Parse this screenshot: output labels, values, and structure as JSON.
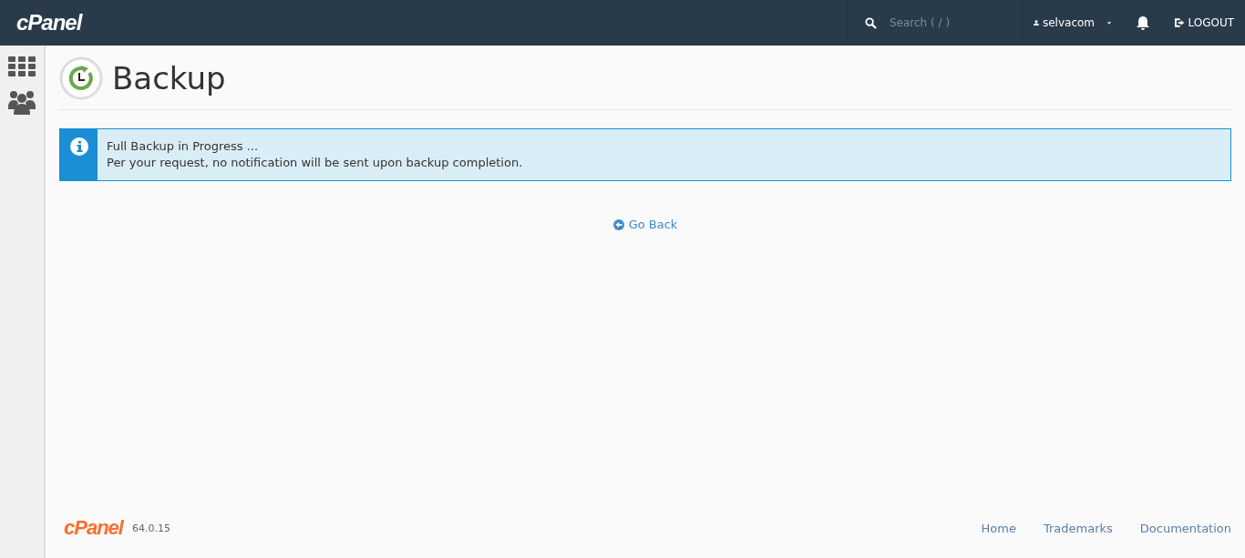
{
  "header": {
    "logo": "cPanel",
    "search": {
      "placeholder": "Search ( / )"
    },
    "user": "selvacom",
    "logout": "LOGOUT"
  },
  "page": {
    "title": "Backup"
  },
  "alert": {
    "title": "Full Backup in Progress ...",
    "message": "Per your request, no notification will be sent upon backup completion."
  },
  "go_back": "Go Back",
  "footer": {
    "logo": "cPanel",
    "version": "64.0.15",
    "links": [
      "Home",
      "Trademarks",
      "Documentation"
    ]
  }
}
